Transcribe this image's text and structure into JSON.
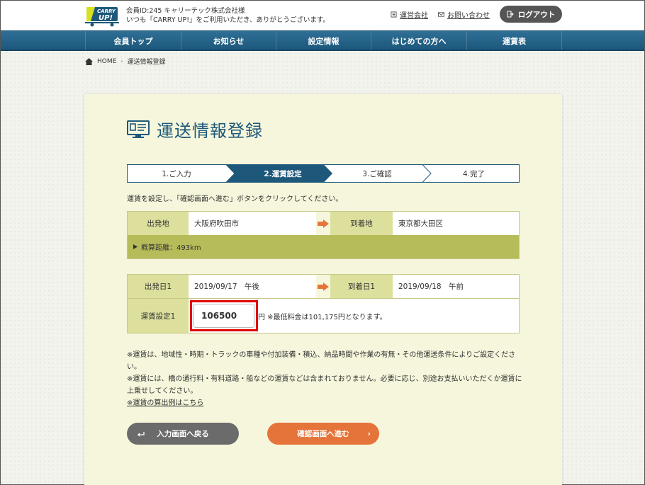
{
  "header": {
    "logo_text_top": "CARRY",
    "logo_text_bottom": "UP!",
    "member_id": "会員ID:245 キャリーテック株式会社様",
    "greeting": "いつも「CARRY UP!」をご利用いただき、ありがとうございます。",
    "company_link": "運営会社",
    "contact_link": "お問い合わせ",
    "logout_label": "ログアウト"
  },
  "nav": [
    "会員トップ",
    "お知らせ",
    "設定情報",
    "はじめての方へ",
    "運賃表"
  ],
  "breadcrumb": {
    "home": "HOME",
    "current": "運送情報登録"
  },
  "page_title": "運送情報登録",
  "steps": [
    "1.ご入力",
    "2.運賃設定",
    "3.ご確認",
    "4.完了"
  ],
  "active_step": 2,
  "instruction": "運賃を設定し、「確認画面へ進む」ボタンをクリックしてください。",
  "route": {
    "origin_label": "出発地",
    "origin_value": "大阪府吹田市",
    "dest_label": "到着地",
    "dest_value": "東京都大田区",
    "distance": "概算距離：493km"
  },
  "schedule": {
    "depart_label": "出発日1",
    "depart_value": "2019/09/17　午後",
    "arrive_label": "到着日1",
    "arrive_value": "2019/09/18　午前",
    "fare_label": "運賃設定1",
    "fare_value": "106500",
    "fare_suffix": "円 ※最低料金は101,175円となります。"
  },
  "notes": {
    "line1": "※運賃は、地域性・時期・トラックの車種や付加装備・積込、納品時間や作業の有無・その他運送条件によりご設定ください。",
    "line2": "※運賃には、橋の通行料・有料道路・船などの運賃などは含まれておりません。必要に応じ、別途お支払いいただくか運賃に上乗せしてください。",
    "link": "※運賃の算出例はこちら"
  },
  "buttons": {
    "back": "入力画面へ戻る",
    "next": "確認画面へ進む"
  },
  "colors": {
    "navy": "#1d587b",
    "orange": "#e5743a",
    "gray_button": "#6b6b6b",
    "label_bg": "#dde09c",
    "distance_bg": "#b6bc5a",
    "highlight": "#e00000"
  }
}
